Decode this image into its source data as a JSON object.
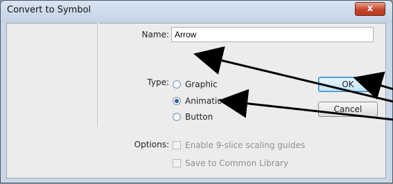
{
  "dialog": {
    "title": "Convert to Symbol",
    "close_glyph": "x",
    "name_label": "Name:",
    "name_value": "Arrow",
    "type_label": "Type:",
    "type_options": [
      {
        "label": "Graphic",
        "selected": false
      },
      {
        "label": "Animation",
        "selected": true
      },
      {
        "label": "Button",
        "selected": false
      }
    ],
    "options_label": "Options:",
    "option_checkboxes": [
      {
        "label": "Enable 9-slice scaling guides",
        "checked": false,
        "enabled": false
      },
      {
        "label": "Save to Common Library",
        "checked": false,
        "enabled": false
      }
    ],
    "ok_label": "OK",
    "cancel_label": "Cancel"
  },
  "annotations": {
    "arrow_color": "#000000",
    "arrow_targets": [
      "name-input",
      "ok-button",
      "type-option-animation"
    ]
  },
  "icons": {
    "close": "close-icon",
    "radio": "radio-button",
    "checkbox": "checkbox"
  },
  "colors": {
    "titlebar": "#c9d7e7",
    "close_button": "#c5452a",
    "ok_button": "#bfe3f8",
    "disabled_text": "#8f8f8f"
  }
}
